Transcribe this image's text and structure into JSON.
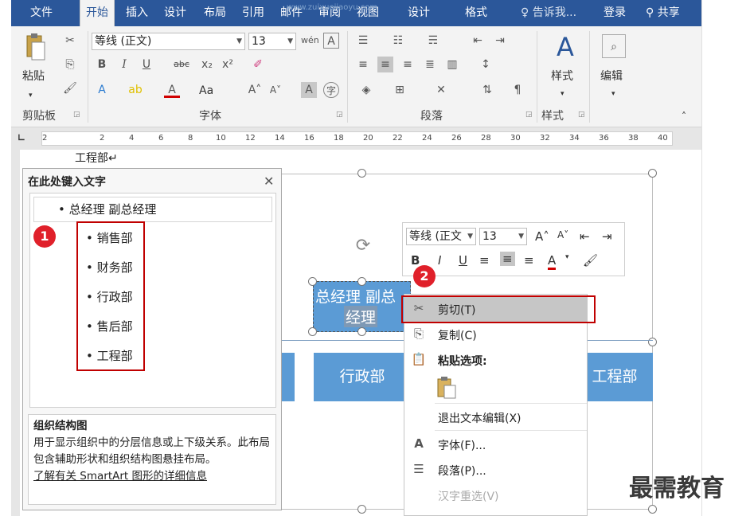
{
  "ribbon": {
    "tabs": [
      {
        "label": "文件",
        "active": false
      },
      {
        "label": "开始",
        "active": true
      },
      {
        "label": "插入",
        "active": false
      },
      {
        "label": "设计",
        "active": false
      },
      {
        "label": "布局",
        "active": false
      },
      {
        "label": "引用",
        "active": false
      },
      {
        "label": "邮件",
        "active": false
      },
      {
        "label": "审阅",
        "active": false
      },
      {
        "label": "视图",
        "active": false
      },
      {
        "label": "设计",
        "active": false
      },
      {
        "label": "格式",
        "active": false
      }
    ],
    "tell_me": "告诉我...",
    "login": "登录",
    "share": "共享",
    "clipboard": {
      "paste_label": "粘贴",
      "group_label": "剪贴板"
    },
    "font": {
      "font_name": "等线 (正文)",
      "font_size": "13",
      "group_label": "字体",
      "aa_label": "Aa"
    },
    "paragraph": {
      "group_label": "段落"
    },
    "styles": {
      "button_label": "样式",
      "group_label": "样式"
    },
    "editing": {
      "button_label": "编辑"
    }
  },
  "ruler": {
    "marks": [
      "2",
      "2",
      "4",
      "6",
      "8",
      "10",
      "12",
      "14",
      "16",
      "18",
      "20",
      "22",
      "24",
      "26",
      "28",
      "30",
      "32",
      "34",
      "36",
      "38",
      "40"
    ]
  },
  "document": {
    "line_text": "工程部↵"
  },
  "text_pane": {
    "title": "在此处键入文字",
    "top_item": "总经理 副总经理",
    "sub_items": [
      "销售部",
      "财务部",
      "行政部",
      "售后部",
      "工程部"
    ],
    "desc_title": "组织结构图",
    "desc_body": "用于显示组织中的分层信息或上下级关系。此布局包含辅助形状和组织结构图悬挂布局。",
    "desc_link": "了解有关 SmartArt 图形的详细信息"
  },
  "smartart": {
    "top_box_line1": "总经理 副总",
    "top_box_line2": "经理",
    "boxes": [
      "行政部",
      "工程部"
    ]
  },
  "mini_toolbar": {
    "font_name": "等线 (正文",
    "font_size": "13"
  },
  "context_menu": {
    "items": [
      {
        "label": "剪切(T)",
        "icon": "scissors-icon",
        "highlighted": true
      },
      {
        "label": "复制(C)",
        "icon": "copy-icon"
      },
      {
        "label": "粘贴选项:",
        "icon": "paste-icon"
      },
      {
        "label": "退出文本编辑(X)",
        "icon": ""
      },
      {
        "label": "字体(F)...",
        "icon": "font-icon"
      },
      {
        "label": "段落(P)...",
        "icon": "paragraph-icon"
      },
      {
        "label": "汉字重选(V)",
        "icon": "",
        "disabled": true
      }
    ]
  },
  "badges": {
    "one": "1",
    "two": "2"
  },
  "watermark": "最需教育",
  "url_watermark": "www.zuixuejiaoyu.com",
  "colors": {
    "ribbon_blue": "#2b579a",
    "smartart_blue": "#5b9bd5",
    "annotation_red": "#c00000"
  }
}
